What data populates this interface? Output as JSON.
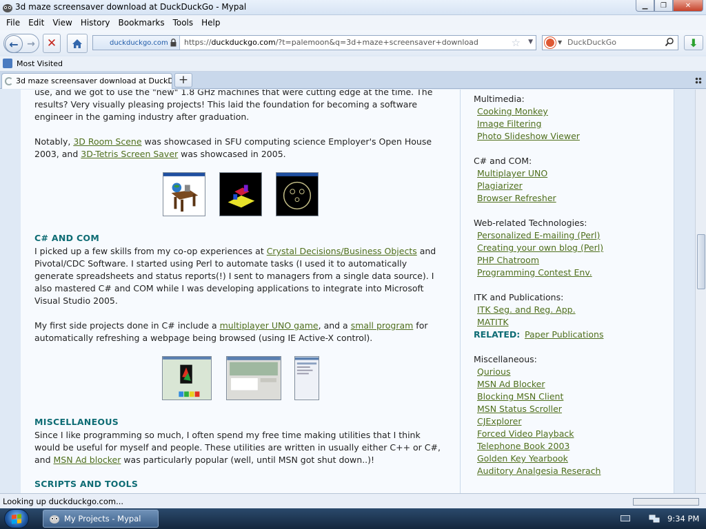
{
  "window": {
    "title": "3d maze screensaver download at DuckDuckGo - Mypal"
  },
  "menu": [
    "File",
    "Edit",
    "View",
    "History",
    "Bookmarks",
    "Tools",
    "Help"
  ],
  "nav": {
    "site_identity": "duckduckgo.com",
    "url_prefix": "https://",
    "url_host": "duckduckgo.com",
    "url_path": "/?t=palemoon&q=3d+maze+screensaver+download",
    "search_engine_placeholder": "DuckDuckGo"
  },
  "bookmarks": {
    "most_visited": "Most Visited"
  },
  "tabs": [
    {
      "label": "3d maze screensaver download at DuckD..."
    }
  ],
  "content": {
    "p1_line1": "use, and we got to use the \"new\" 1.8 GHz machines that were cutting edge at the time. The",
    "p1_line2": "results? Very visually pleasing projects! This laid the foundation for becoming a software",
    "p1_line3": "engineer in the gaming industry after graduation.",
    "p2_line1_pre": "Notably, ",
    "p2_link1": "3D Room Scene",
    "p2_line1_post": " was showcased in SFU computing science Employer's Open House",
    "p2_line2_pre": "2003, and ",
    "p2_link2": "3D-Tetris Screen Saver",
    "p2_line2_post": " was showcased in 2005.",
    "h_csharp": "C# AND COM",
    "p3_line1_pre": "I picked up a few skills from my co-op experiences at ",
    "p3_link": "Crystal Decisions/Business Objects",
    "p3_line1_post": " and",
    "p3_line2": "Pivotal/CDC Software. I started using Perl to automate tasks (I used it to automatically",
    "p3_line3": "generate spreadsheets and status reports(!) I sent to managers from a single data source). I",
    "p3_line4": "also mastered C# and COM while I was developing applications to integrate into Microsoft",
    "p3_line5": "Visual Studio 2005.",
    "p4_line1_pre": "My first side projects done in C# include a ",
    "p4_link1": "multiplayer UNO game",
    "p4_line1_mid": ", and a ",
    "p4_link2": "small program",
    "p4_line1_post": " for",
    "p4_line2": "automatically refreshing a webpage being browsed (using IE Active-X control).",
    "h_misc": "MISCELLANEOUS",
    "p5_line1": "Since I like programming so much, I often spend my free time making utilities that I think",
    "p5_line2": "would be useful for myself and people. These utilities are written in usually either C++ or C#,",
    "p5_line3_pre": "and ",
    "p5_link": "MSN Ad blocker",
    "p5_line3_post": " was particularly popular (well, until MSN got shut down..)!",
    "h_scripts": "SCRIPTS AND TOOLS"
  },
  "sidebar": {
    "multimedia_label": "Multimedia:",
    "multimedia": [
      "Cooking Monkey",
      "Image Filtering",
      "Photo Slideshow Viewer"
    ],
    "csharp_label": "C# and COM:",
    "csharp": [
      "Multiplayer UNO",
      "Plagiarizer",
      "Browser Refresher"
    ],
    "web_label": "Web-related Technologies:",
    "web": [
      "Personalized E-mailing (Perl)",
      "Creating your own blog (Perl)",
      "PHP Chatroom",
      "Programming Contest Env."
    ],
    "itk_label": "ITK and Publications:",
    "itk": [
      "ITK Seg. and Reg. App.",
      "MATITK"
    ],
    "related_label": "RELATED:",
    "related_link": "Paper Publications",
    "misc_label": "Miscellaneous:",
    "misc": [
      "Qurious",
      "MSN Ad Blocker",
      "Blocking MSN Client",
      "MSN Status Scroller",
      "CJExplorer",
      "Forced Video Playback",
      "Telephone Book 2003",
      "Golden Key Yearbook",
      "Auditory Analgesia Reserach"
    ]
  },
  "status": {
    "text": "Looking up duckduckgo.com..."
  },
  "taskbar": {
    "task_label": "My Projects - Mypal",
    "clock": "9:34 PM"
  }
}
